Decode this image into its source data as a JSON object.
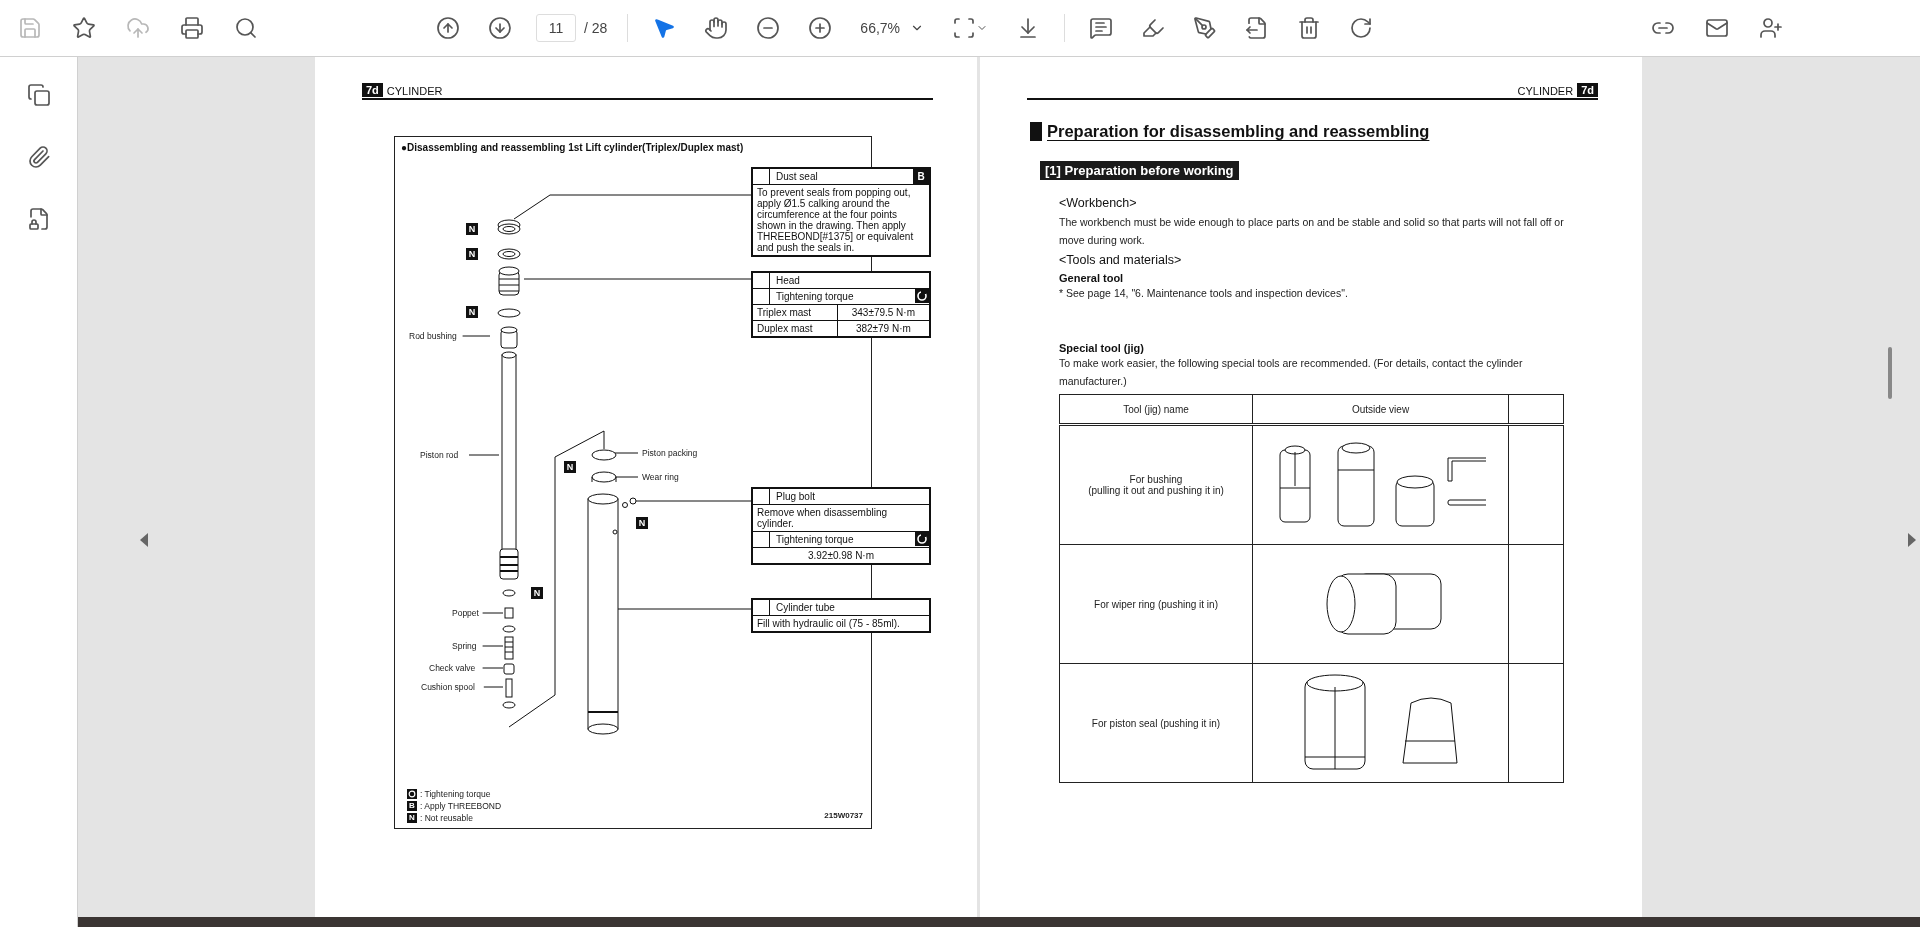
{
  "toolbar": {
    "left_tools": [
      {
        "kind": "save",
        "disabled": true
      },
      {
        "kind": "bookmark",
        "disabled": false
      },
      {
        "kind": "upload",
        "disabled": true
      },
      {
        "kind": "print",
        "disabled": false
      },
      {
        "kind": "search",
        "disabled": false
      }
    ],
    "page_current": "11",
    "page_total": "/ 28",
    "zoom": "66,7%",
    "modes": [
      {
        "kind": "select",
        "selected": true
      },
      {
        "kind": "hand",
        "selected": false
      }
    ]
  },
  "left_page": {
    "header": {
      "tag": "7d",
      "title": "CYLINDER"
    },
    "diagram": {
      "title": "●Disassembling and reassembling 1st Lift cylinder(Triplex/Duplex mast)",
      "callouts": [
        {
          "kind": "note",
          "name": "Dust seal",
          "badge": "B",
          "text": "To prevent seals from popping out, apply Ø1.5 calking around the circumference at the four points shown in the drawing. Then apply THREEBOND[#1375] or equivalent and push the seals in."
        },
        {
          "kind": "torque_table",
          "name": "Head",
          "torque_label": "Tightening torque",
          "rows": [
            {
              "label": "Triplex mast",
              "value": "343±79.5 N·m"
            },
            {
              "label": "Duplex mast",
              "value": "382±79 N·m"
            }
          ]
        },
        {
          "kind": "note_torque",
          "name": "Plug bolt",
          "text": "Remove when disassembling cylinder.",
          "torque_label": "Tightening torque",
          "value": "3.92±0.98 N·m"
        },
        {
          "kind": "note",
          "name": "Cylinder tube",
          "text": "Fill with hydraulic oil (75 - 85ml)."
        }
      ],
      "part_labels": [
        "Rod bushing",
        "Piston rod",
        "Piston packing",
        "Wear ring",
        "Poppet",
        "Spring",
        "Check valve",
        "Cushion spool"
      ],
      "n_marks": [
        "N",
        "N",
        "N",
        "N",
        "N",
        "N"
      ],
      "legend": [
        {
          "kind": "icon",
          "text": ": Tightening torque"
        },
        {
          "kind": "letter",
          "symbol": "B",
          "text": ": Apply THREEBOND"
        },
        {
          "kind": "letter",
          "symbol": "N",
          "text": ": Not reusable"
        }
      ],
      "drawing_code": "215W0737"
    }
  },
  "right_page": {
    "header": {
      "title": "CYLINDER",
      "tag": "7d"
    },
    "heading": "Preparation for disassembling and reassembling",
    "section": "[1] Preparation before working",
    "blocks": [
      {
        "kind": "subhead",
        "text": "<Workbench>"
      },
      {
        "kind": "para",
        "text": "The workbench must be wide enough to place parts on and be stable and solid so that parts will not fall off or move during work."
      },
      {
        "kind": "subhead",
        "text": "<Tools and materials>"
      },
      {
        "kind": "label",
        "text": "General tool"
      },
      {
        "kind": "para",
        "text": "* See page 14, \"6. Maintenance tools and inspection devices\"."
      },
      {
        "kind": "label",
        "text": "Special tool (jig)"
      },
      {
        "kind": "para",
        "text": "To make work easier, the following special tools are recommended. (For details, contact the cylinder manufacturer.)"
      }
    ],
    "tools_table": {
      "columns": [
        "Tool (jig) name",
        "Outside view"
      ],
      "rows": [
        {
          "name": "For bushing\n(pulling it out and pushing it in)",
          "kind": "bushing"
        },
        {
          "name": "For wiper ring (pushing it in)",
          "kind": "wiper"
        },
        {
          "name": "For piston seal (pushing it in)",
          "kind": "piston"
        }
      ]
    }
  }
}
